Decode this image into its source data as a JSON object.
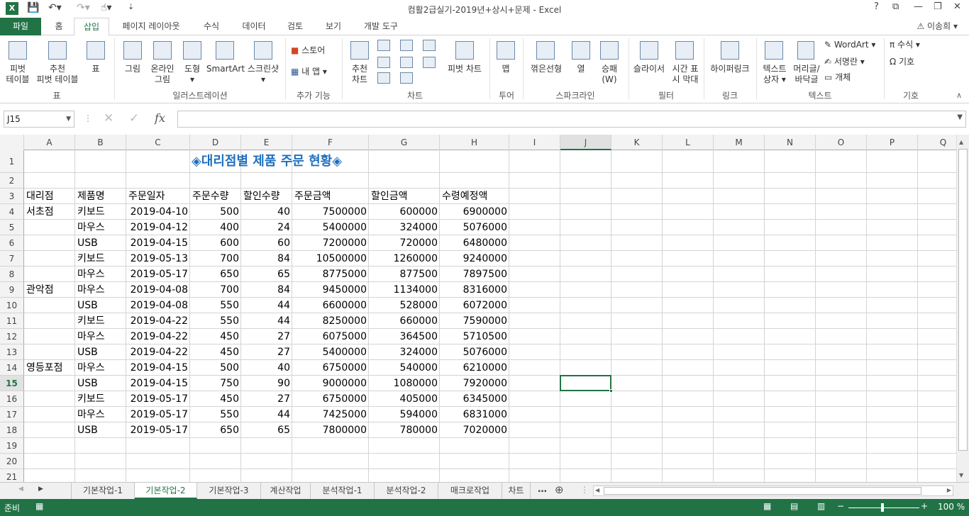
{
  "window": {
    "title": "컴활2급실기-2019년+상시+문제 - Excel",
    "controls": [
      "?",
      "⧉",
      "—",
      "❐",
      "✕"
    ]
  },
  "tabs": [
    {
      "label": "파일"
    },
    {
      "label": "홈"
    },
    {
      "label": "삽입"
    },
    {
      "label": "페이지 레이아웃"
    },
    {
      "label": "수식"
    },
    {
      "label": "데이터"
    },
    {
      "label": "검토"
    },
    {
      "label": "보기"
    },
    {
      "label": "개발 도구"
    }
  ],
  "user": "⚠ 이송희 ▾",
  "ribbon": {
    "pivot": "피벗\n테이블",
    "recpivot": "추천\n피벗 테이블",
    "table": "표",
    "g_table": "표",
    "picture": "그림",
    "online": "온라인\n그림",
    "shapes": "도형\n▾",
    "smartart": "SmartArt",
    "screenshot": "스크린샷\n▾",
    "g_illust": "일러스트레이션",
    "store": "스토어",
    "myapps": "내 앱 ▾",
    "g_addin": "추가 기능",
    "recchart": "추천\n차트",
    "pivotchart": "피벗 차트",
    "g_chart": "차트",
    "map": "맵",
    "g_tour": "투어",
    "sp_line": "꺾은선형",
    "sp_col": "열",
    "sp_wl": "승패\n(W)",
    "g_spark": "스파크라인",
    "slicer": "슬라이서",
    "timeline": "시간 표\n시 막대",
    "g_filter": "필터",
    "hyperlink": "하이퍼링크",
    "g_link": "링크",
    "textbox": "텍스트\n상자 ▾",
    "header": "머리글/\n바닥글",
    "wordart": "WordArt ▾",
    "signature": "서명란 ▾",
    "object": "개체",
    "g_text": "텍스트",
    "equation": "π 수식 ▾",
    "symbol": "Ω 기호",
    "g_symbol": "기호"
  },
  "namebox": "J15",
  "fx": "fx",
  "columns": [
    "A",
    "B",
    "C",
    "D",
    "E",
    "F",
    "G",
    "H",
    "I",
    "J",
    "K",
    "L",
    "M",
    "N",
    "O",
    "P",
    "Q"
  ],
  "selected_col": "J",
  "selected_row": "15",
  "sheet_title": "◈대리점별 제품 주문 현황◈",
  "headers": [
    "대리점",
    "제품명",
    "주문일자",
    "주문수량",
    "할인수량",
    "주문금액",
    "할인금액",
    "수령예정액"
  ],
  "rows": [
    [
      "서초점",
      "키보드",
      "2019-04-10",
      "500",
      "40",
      "7500000",
      "600000",
      "6900000"
    ],
    [
      "",
      "마우스",
      "2019-04-12",
      "400",
      "24",
      "5400000",
      "324000",
      "5076000"
    ],
    [
      "",
      "USB",
      "2019-04-15",
      "600",
      "60",
      "7200000",
      "720000",
      "6480000"
    ],
    [
      "",
      "키보드",
      "2019-05-13",
      "700",
      "84",
      "10500000",
      "1260000",
      "9240000"
    ],
    [
      "",
      "마우스",
      "2019-05-17",
      "650",
      "65",
      "8775000",
      "877500",
      "7897500"
    ],
    [
      "관악점",
      "마우스",
      "2019-04-08",
      "700",
      "84",
      "9450000",
      "1134000",
      "8316000"
    ],
    [
      "",
      "USB",
      "2019-04-08",
      "550",
      "44",
      "6600000",
      "528000",
      "6072000"
    ],
    [
      "",
      "키보드",
      "2019-04-22",
      "550",
      "44",
      "8250000",
      "660000",
      "7590000"
    ],
    [
      "",
      "마우스",
      "2019-04-22",
      "450",
      "27",
      "6075000",
      "364500",
      "5710500"
    ],
    [
      "",
      "USB",
      "2019-04-22",
      "450",
      "27",
      "5400000",
      "324000",
      "5076000"
    ],
    [
      "영등포점",
      "마우스",
      "2019-04-15",
      "500",
      "40",
      "6750000",
      "540000",
      "6210000"
    ],
    [
      "",
      "USB",
      "2019-04-15",
      "750",
      "90",
      "9000000",
      "1080000",
      "7920000"
    ],
    [
      "",
      "키보드",
      "2019-05-17",
      "450",
      "27",
      "6750000",
      "405000",
      "6345000"
    ],
    [
      "",
      "마우스",
      "2019-05-17",
      "550",
      "44",
      "7425000",
      "594000",
      "6831000"
    ],
    [
      "",
      "USB",
      "2019-05-17",
      "650",
      "65",
      "7800000",
      "780000",
      "7020000"
    ]
  ],
  "row_numbers": [
    "1",
    "2",
    "3",
    "4",
    "5",
    "6",
    "7",
    "8",
    "9",
    "10",
    "11",
    "12",
    "13",
    "14",
    "15",
    "16",
    "17",
    "18",
    "19",
    "20",
    "21"
  ],
  "sheets": [
    {
      "label": "기본작업-1"
    },
    {
      "label": "기본작업-2"
    },
    {
      "label": "기본작업-3"
    },
    {
      "label": "계산작업"
    },
    {
      "label": "분석작업-1"
    },
    {
      "label": "분석작업-2"
    },
    {
      "label": "매크로작업"
    },
    {
      "label": "차트"
    }
  ],
  "status": {
    "ready": "준비",
    "zoom": "100 %"
  },
  "colors": {
    "accent": "#217346",
    "title_text": "#1f6fbf"
  }
}
